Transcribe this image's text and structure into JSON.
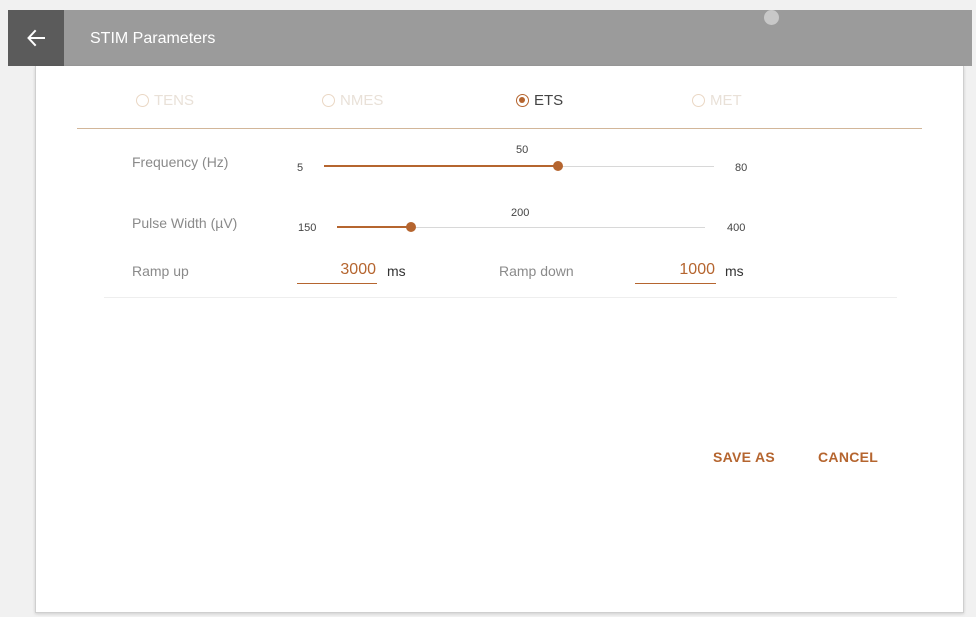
{
  "header": {
    "title": "STIM Parameters",
    "back_icon": "arrow-left-icon"
  },
  "modes": [
    {
      "label": "TENS",
      "selected": false
    },
    {
      "label": "NMES",
      "selected": false
    },
    {
      "label": "ETS",
      "selected": true
    },
    {
      "label": "MET",
      "selected": false
    }
  ],
  "frequency": {
    "label": "Frequency (Hz)",
    "min": "5",
    "max": "80",
    "value": "50",
    "fraction": 0.6
  },
  "pulse_width": {
    "label": "Pulse Width (µV)",
    "min": "150",
    "max": "400",
    "value": "200",
    "fraction": 0.2
  },
  "ramp_up": {
    "label": "Ramp up",
    "value": "3000",
    "unit": "ms"
  },
  "ramp_down": {
    "label": "Ramp down",
    "value": "1000",
    "unit": "ms"
  },
  "actions": {
    "save_as": "SAVE AS",
    "cancel": "CANCEL"
  },
  "colors": {
    "accent": "#b5652f",
    "appbar": "#9b9b9b",
    "back_button": "#5b5b5b",
    "disabled_text": "#e9e1d8"
  }
}
